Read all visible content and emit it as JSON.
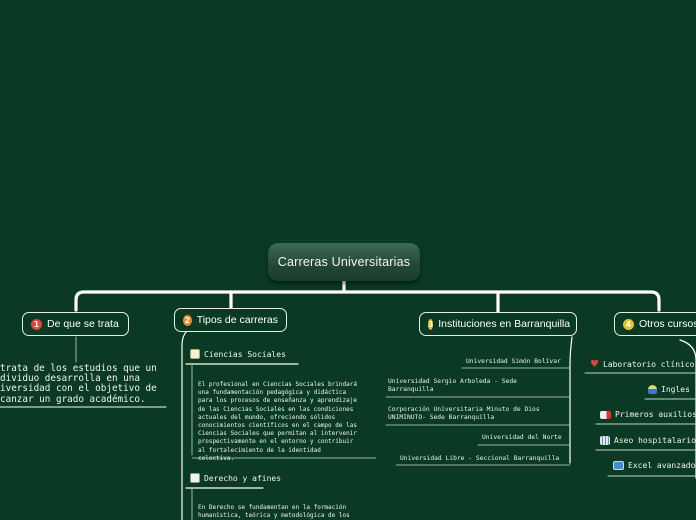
{
  "root": {
    "title": "Carreras Universitarias"
  },
  "colors": {
    "background": "#0a3a24",
    "line": "#ffffff",
    "num1": "#e0443b",
    "num2": "#ef8a2c",
    "num3": "#e2b81e",
    "num4": "#e7c522"
  },
  "topics": [
    {
      "number": "1",
      "label": "De que se trata",
      "text": "trata de los estudios que un\ndividuo desarrolla en una\niversidad con el objetivo de\ncanzar un grado académico."
    },
    {
      "number": "2",
      "label": "Tipos de carreras",
      "subtopics": [
        {
          "label": "Ciencias Sociales",
          "icon": "notepad-icon",
          "text": "El profesional en Ciencias Sociales brindará\nuna fundamentación pedagógica y didáctica\npara los procesos de enseñanza y aprendizaje\nde las Ciencias Sociales en las condiciones\nactuales del mundo, ofreciendo sólidos\nconocimientos científicos en el campo de las\nCiencias Sociales que permitan al intervenir\nprospectivamente en el entorno y contribuir\nal fortalecimiento de la identidad\ncolectiva."
        },
        {
          "label": "Derecho y afines",
          "icon": "chart-icon",
          "text": "En Derecho se fundamentan en la formación\nhumanística, teórica y metodológica de los"
        }
      ]
    },
    {
      "number": "3",
      "label": "Instituciones en Barranquilla",
      "items": [
        "Universidad Simón Bolívar",
        "Universidad Sergio Arboleda - Sede\nBarranquilla",
        "Corporación Universitaria Minuto de Dios\nUNIMINUTO- Sede Barranquilla",
        "Universidad del Norte",
        "Universidad Libre - Seccional Barranquilla"
      ]
    },
    {
      "number": "4",
      "label": "Otros cursos",
      "items": [
        {
          "label": "Laboratorio clínico",
          "icon": "heart-icon"
        },
        {
          "label": "Ingles",
          "icon": "person-icon"
        },
        {
          "label": "Primeros auxilios",
          "icon": "ambulance-icon"
        },
        {
          "label": "Aseo hospitalario",
          "icon": "hospital-icon"
        },
        {
          "label": "Excel avanzado",
          "icon": "computer-icon"
        }
      ]
    }
  ]
}
